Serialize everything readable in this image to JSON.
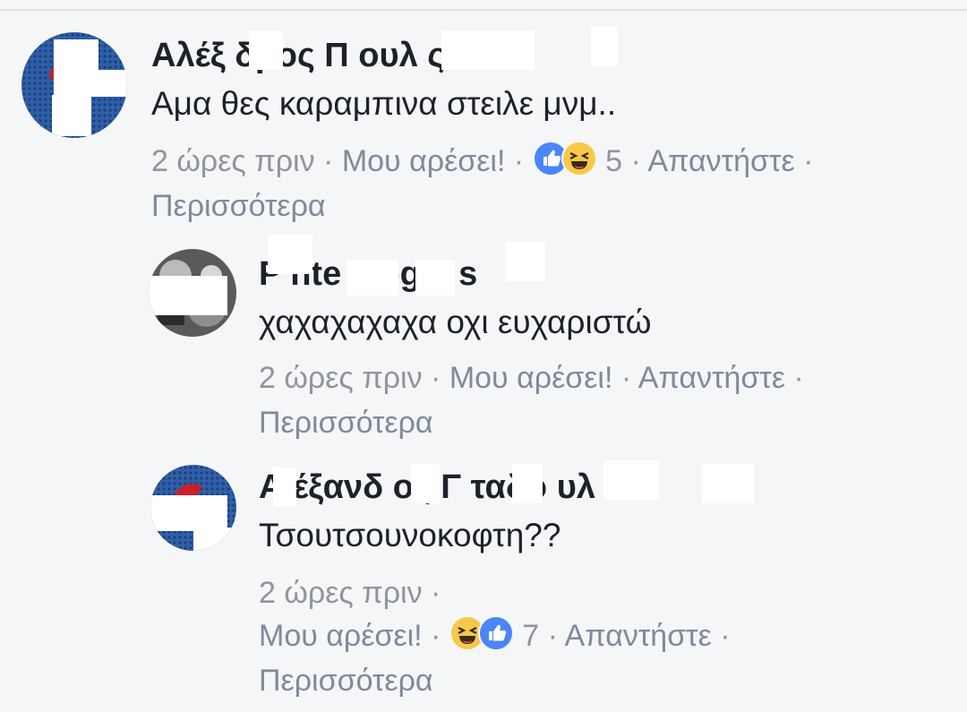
{
  "comments": [
    {
      "author": "Αλέξ   δρος Π              ουλ  ς",
      "text": "Αμα θες καραμπινα στειλε μνμ..",
      "time": "2 ώρες πριν",
      "like": "Μου αρέσει!",
      "reaction_count": "5",
      "reply": "Απαντήστε",
      "more": "Περισσότερα",
      "reactions": [
        "like-icon",
        "haha-icon"
      ]
    },
    {
      "author": "P  nte    s   ogis  s",
      "text": "χαχαχαχαχα οχι ευχαριστώ",
      "time": "2 ώρες πριν",
      "like": "Μου αρέσει!",
      "reply": "Απαντήστε",
      "more": "Περισσότερα"
    },
    {
      "author": "Α  έξανδ  ος Γ    ταδο     υλ",
      "text": "Τσουτσουνοκοφτη??",
      "time": "2 ώρες πριν",
      "like": "Μου αρέσει!",
      "reaction_count": "7",
      "reply": "Απαντήστε",
      "more": "Περισσότερα",
      "reactions": [
        "haha-icon",
        "like-icon"
      ]
    }
  ],
  "separator": "·",
  "colors": {
    "background": "#f5f6f7",
    "author": "#1d2129",
    "meta": "#90949c",
    "link": "#7f8a9c",
    "like": "#4a86f7",
    "haha": "#f7c84a"
  }
}
